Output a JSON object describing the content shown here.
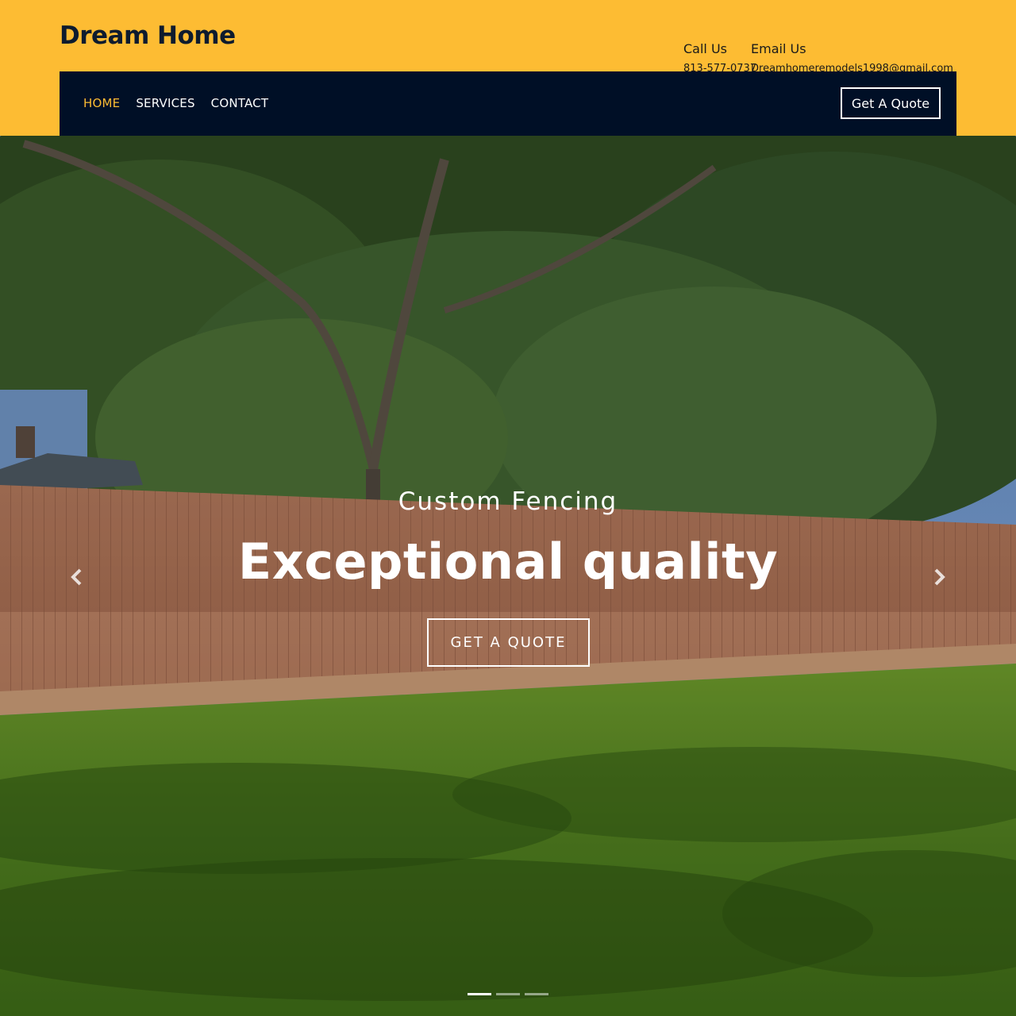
{
  "brand": {
    "name": "Dream Home"
  },
  "contact": {
    "call_label": "Call Us",
    "call_value": "813-577-0737",
    "email_label": "Email Us",
    "email_value": "Dreamhomeremodels1998@gmail.com"
  },
  "nav": {
    "items": [
      {
        "label": "HOME",
        "active": true
      },
      {
        "label": "SERVICES",
        "active": false
      },
      {
        "label": "CONTACT",
        "active": false
      }
    ],
    "quote_button": "Get A Quote"
  },
  "hero": {
    "subtitle": "Custom Fencing",
    "title": "Exceptional quality",
    "cta": "GET A QUOTE",
    "prev_icon": "chevron-left-icon",
    "next_icon": "chevron-right-icon",
    "slide_count": 3,
    "active_slide": 0
  },
  "colors": {
    "accent": "#fdbc33",
    "navbar": "#000f26",
    "brand_text": "#0d1b2e"
  }
}
